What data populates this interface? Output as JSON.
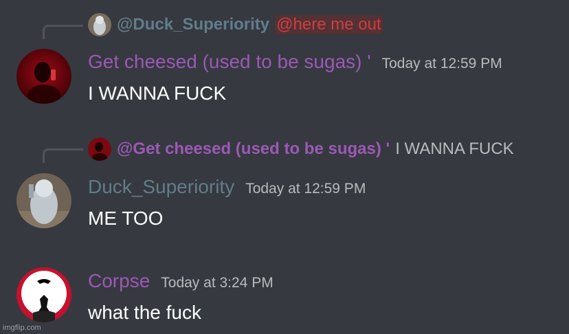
{
  "colors": {
    "background": "#36393f",
    "purple_name": "#9b59b6",
    "gray_name": "#607d8b",
    "mention_red": "#cf3e3e",
    "text": "#ffffff",
    "muted": "#b9bbbe"
  },
  "messages": [
    {
      "reply": {
        "author": "@Duck_Superiority",
        "author_color": "#607d8b",
        "preview": "@here me out",
        "preview_style": "mention",
        "avatar_icon": "duck-avatar-icon"
      },
      "author": "Get cheesed (used to be sugas) '",
      "author_color": "#9b59b6",
      "timestamp": "Today at 12:59 PM",
      "content": "I WANNA FUCK",
      "avatar_icon": "red-photo-avatar-icon"
    },
    {
      "reply": {
        "author": "@Get cheesed (used to be sugas) '",
        "author_color": "#9b59b6",
        "preview": "I WANNA FUCK",
        "preview_style": "plain",
        "avatar_icon": "red-photo-avatar-icon"
      },
      "author": "Duck_Superiority",
      "author_color": "#607d8b",
      "timestamp": "Today at 12:59 PM",
      "content": "ME TOO",
      "avatar_icon": "duck-avatar-icon"
    },
    {
      "author": "Corpse",
      "author_color": "#9b59b6",
      "timestamp": "Today at 3:24 PM",
      "content": "what the fuck",
      "avatar_icon": "corpse-avatar-icon"
    }
  ],
  "watermark": "imgflip.com"
}
